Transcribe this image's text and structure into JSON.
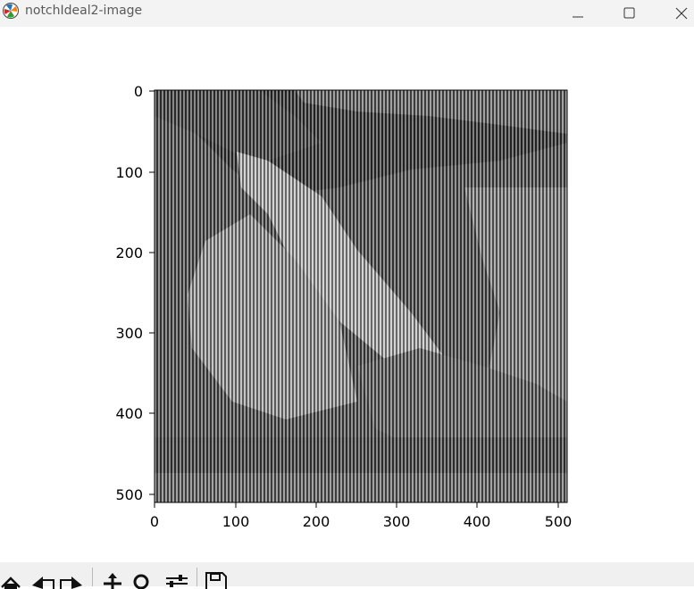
{
  "window": {
    "title": "notchIdeal2-image",
    "icon": "matplotlib-logo-icon",
    "controls": [
      "minimize-icon",
      "maximize-icon",
      "close-icon"
    ]
  },
  "figure": {
    "axes": {
      "x_ticks": [
        "0",
        "100",
        "200",
        "300",
        "400",
        "500"
      ],
      "y_ticks": [
        "0",
        "100",
        "200",
        "300",
        "400",
        "500"
      ]
    },
    "image": {
      "description": "grayscale image with vertical stripe pattern",
      "colormap": "gray"
    }
  },
  "chart_data": {
    "type": "heatmap",
    "x_range": [
      0,
      512
    ],
    "y_range": [
      0,
      512
    ],
    "x_ticks": [
      0,
      100,
      200,
      300,
      400,
      500
    ],
    "y_ticks": [
      0,
      100,
      200,
      300,
      400,
      500
    ],
    "y_inverted": true,
    "colormap": "gray"
  },
  "toolbar": {
    "buttons": [
      "home-icon",
      "back-icon",
      "forward-icon",
      "pan-icon",
      "zoom-icon",
      "configure-subplots-icon",
      "save-icon"
    ]
  }
}
